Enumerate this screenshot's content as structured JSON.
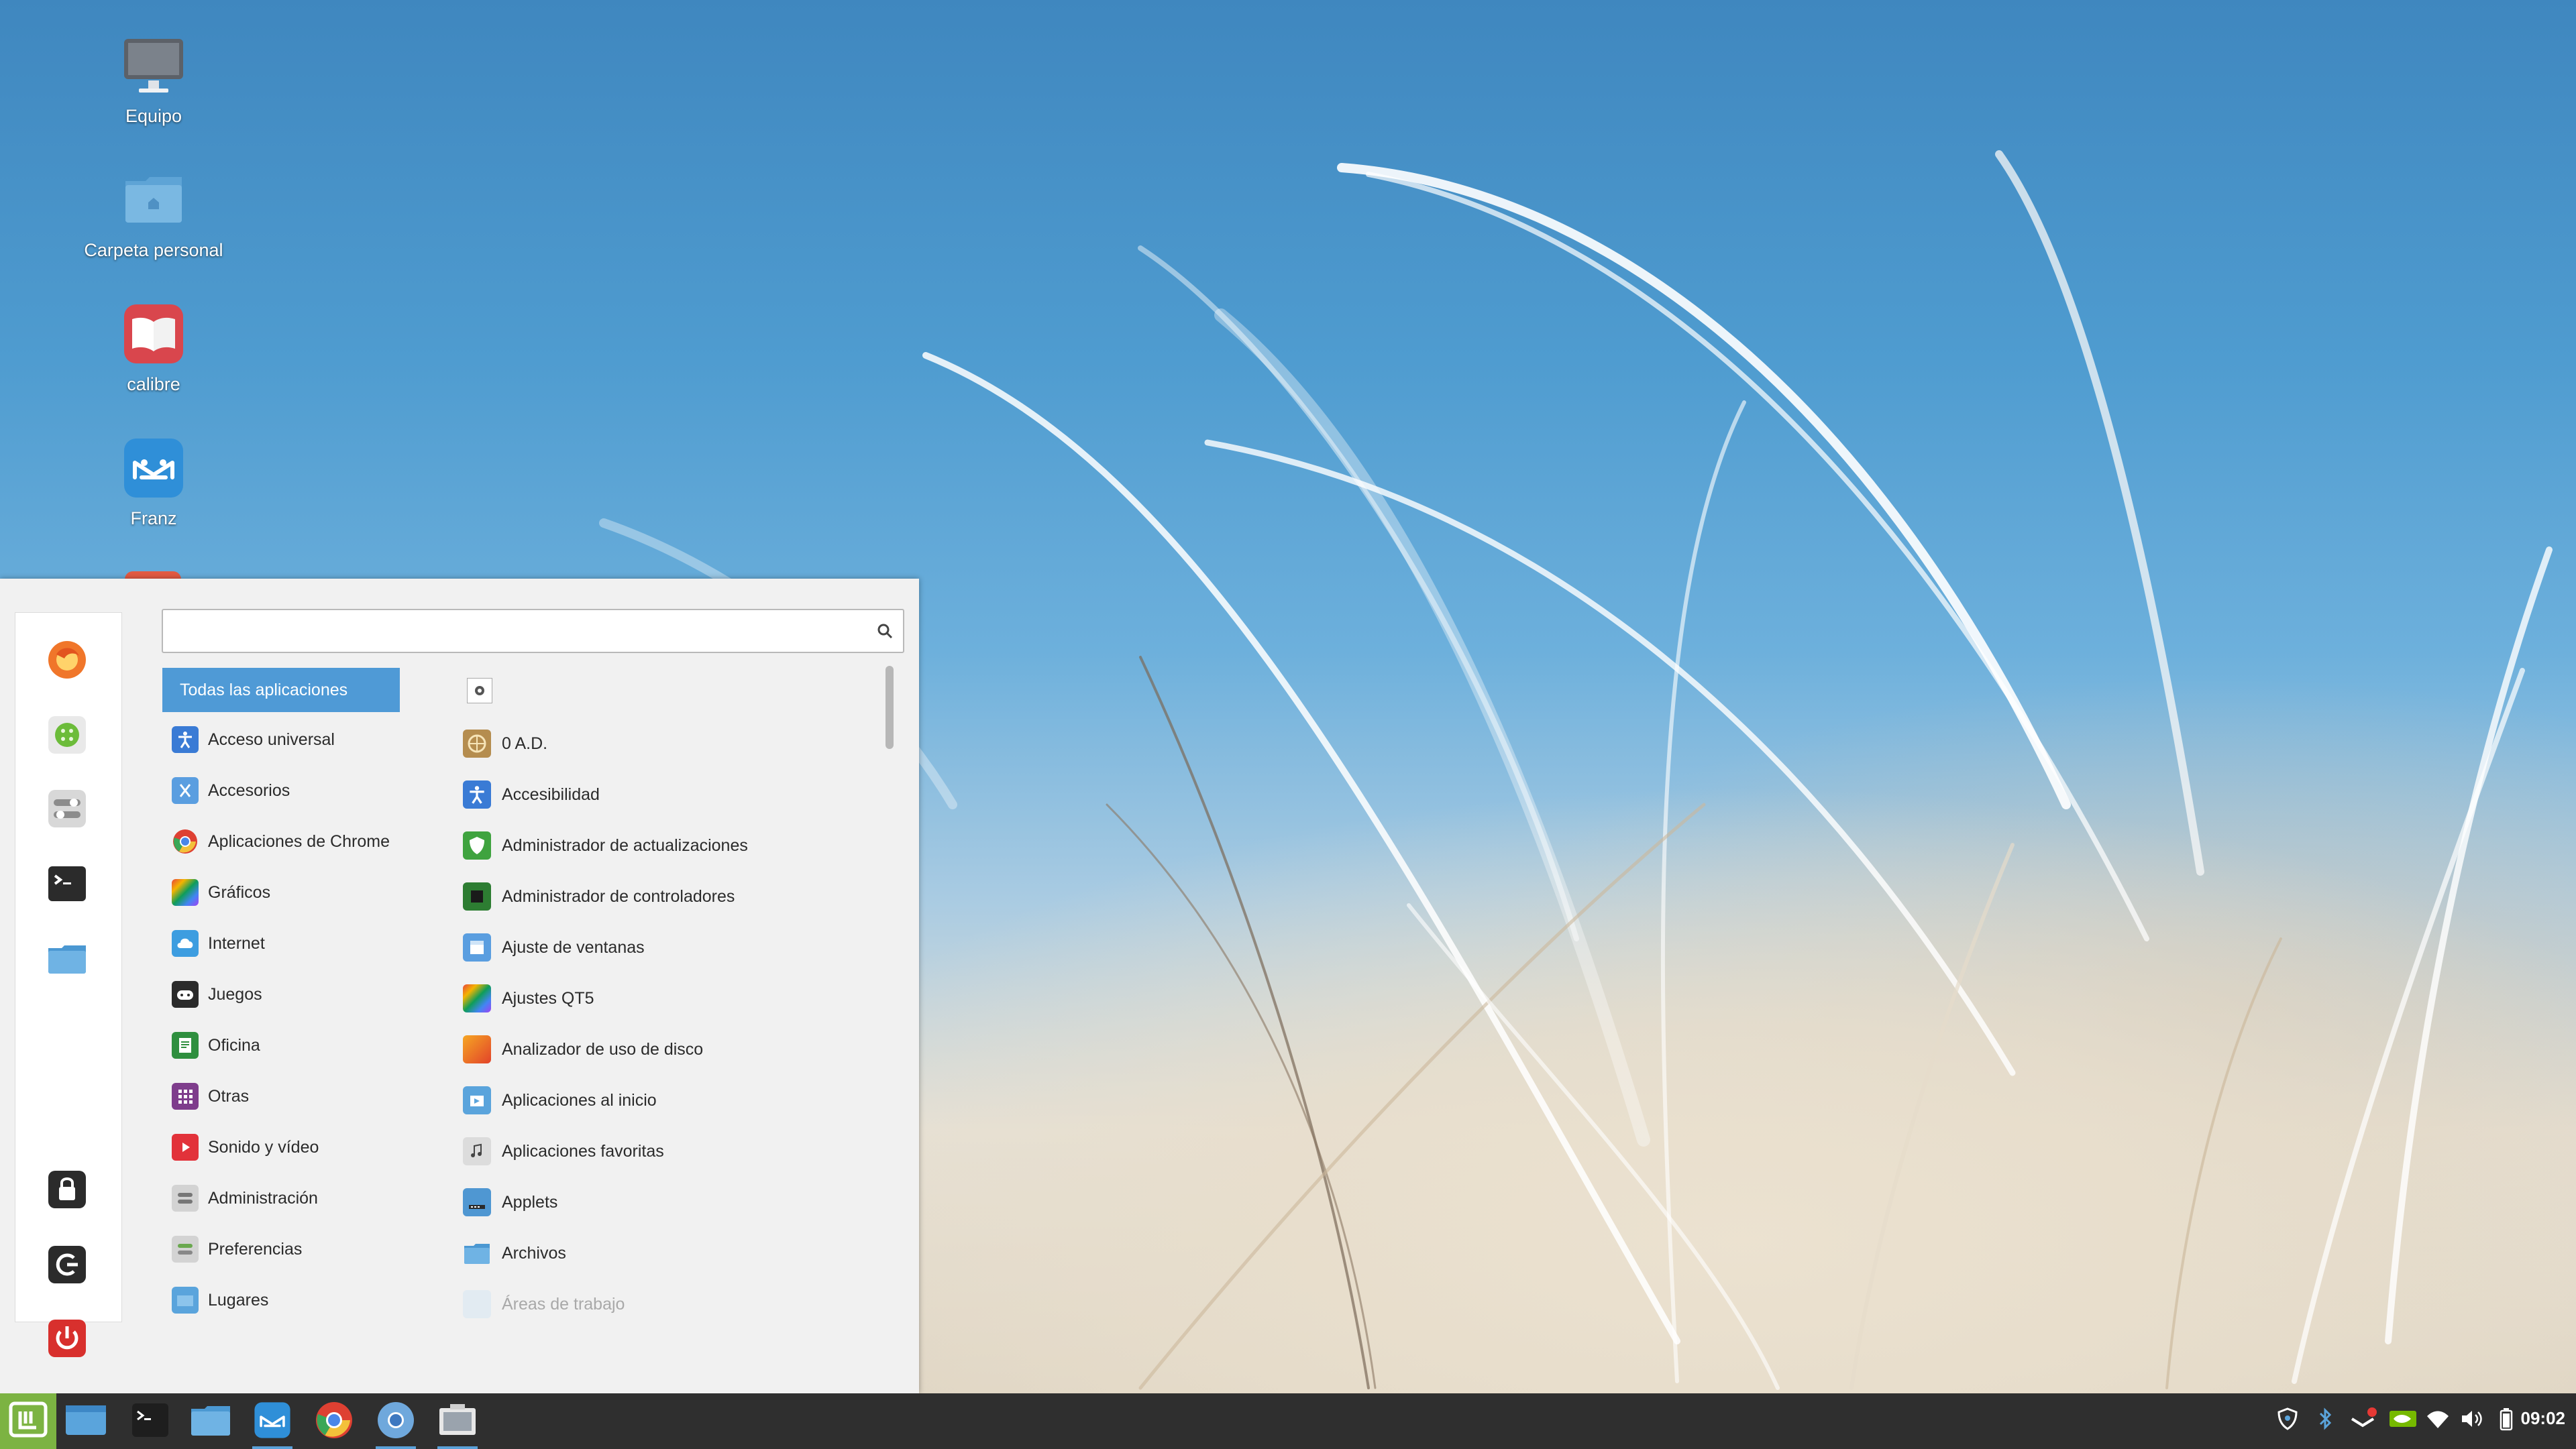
{
  "desktop": {
    "icons": [
      {
        "label": "Equipo",
        "icon": "computer-icon"
      },
      {
        "label": "Carpeta personal",
        "icon": "home-folder-icon"
      },
      {
        "label": "calibre",
        "icon": "calibre-icon"
      },
      {
        "label": "Franz",
        "icon": "franz-icon"
      }
    ]
  },
  "menu": {
    "search": {
      "value": "",
      "placeholder": ""
    },
    "favorites": [
      "firefox-icon",
      "green-apps-icon",
      "settings-toggle-icon",
      "terminal-icon",
      "folder-icon"
    ],
    "session": [
      "lock-icon",
      "logout-icon",
      "power-icon"
    ],
    "categories": [
      {
        "label": "Todas las aplicaciones",
        "selected": true
      },
      {
        "label": "Acceso universal",
        "icon": "accessibility-icon"
      },
      {
        "label": "Accesorios",
        "icon": "accessories-icon"
      },
      {
        "label": "Aplicaciones de Chrome",
        "icon": "chrome-icon"
      },
      {
        "label": "Gráficos",
        "icon": "graphics-icon"
      },
      {
        "label": "Internet",
        "icon": "internet-icon"
      },
      {
        "label": "Juegos",
        "icon": "games-icon"
      },
      {
        "label": "Oficina",
        "icon": "office-icon"
      },
      {
        "label": "Otras",
        "icon": "other-icon"
      },
      {
        "label": "Sonido y vídeo",
        "icon": "sound-video-icon"
      },
      {
        "label": "Administración",
        "icon": "admin-icon"
      },
      {
        "label": "Preferencias",
        "icon": "preferences-icon"
      },
      {
        "label": "Lugares",
        "icon": "places-folder-icon"
      }
    ],
    "apps": [
      {
        "label": "0 A.D.",
        "icon": "0ad-icon"
      },
      {
        "label": "Accesibilidad",
        "icon": "accessibility-icon"
      },
      {
        "label": "Administrador de actualizaciones",
        "icon": "update-shield-icon"
      },
      {
        "label": "Administrador de controladores",
        "icon": "driver-manager-icon"
      },
      {
        "label": "Ajuste de ventanas",
        "icon": "window-tiling-icon"
      },
      {
        "label": "Ajustes QT5",
        "icon": "qt5-settings-icon"
      },
      {
        "label": "Analizador de uso de disco",
        "icon": "disk-usage-icon"
      },
      {
        "label": "Aplicaciones al inicio",
        "icon": "startup-apps-icon"
      },
      {
        "label": "Aplicaciones favoritas",
        "icon": "favorite-apps-icon"
      },
      {
        "label": "Applets",
        "icon": "applets-icon"
      },
      {
        "label": "Archivos",
        "icon": "files-folder-icon"
      },
      {
        "label": "Áreas de trabajo",
        "icon": "workspaces-icon"
      }
    ]
  },
  "taskbar": {
    "launchers": [
      "mint-menu-icon",
      "show-desktop-icon",
      "terminal-icon",
      "files-icon",
      "franz-icon",
      "chrome-icon",
      "chromium-icon",
      "screenshot-icon"
    ],
    "tray": [
      "shield-icon",
      "bluetooth-icon",
      "network-alert-icon",
      "nvidia-icon",
      "wifi-icon",
      "volume-icon",
      "battery-icon"
    ],
    "clock": "09:02"
  }
}
